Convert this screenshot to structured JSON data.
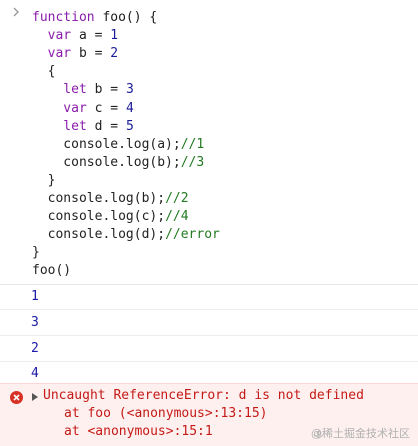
{
  "input": {
    "lines": [
      {
        "parts": [
          {
            "t": "function",
            "c": "kw"
          },
          {
            "t": " foo() {",
            "c": "fn"
          }
        ]
      },
      {
        "parts": [
          {
            "t": "  var",
            "c": "kw"
          },
          {
            "t": " a = ",
            "c": "plain"
          },
          {
            "t": "1",
            "c": "num"
          }
        ]
      },
      {
        "parts": [
          {
            "t": "  var",
            "c": "kw"
          },
          {
            "t": " b = ",
            "c": "plain"
          },
          {
            "t": "2",
            "c": "num"
          }
        ]
      },
      {
        "parts": [
          {
            "t": "  {",
            "c": "plain"
          }
        ]
      },
      {
        "parts": [
          {
            "t": "    let",
            "c": "kw"
          },
          {
            "t": " b = ",
            "c": "plain"
          },
          {
            "t": "3",
            "c": "num"
          }
        ]
      },
      {
        "parts": [
          {
            "t": "    var",
            "c": "kw"
          },
          {
            "t": " c = ",
            "c": "plain"
          },
          {
            "t": "4",
            "c": "num"
          }
        ]
      },
      {
        "parts": [
          {
            "t": "    let",
            "c": "kw"
          },
          {
            "t": " d = ",
            "c": "plain"
          },
          {
            "t": "5",
            "c": "num"
          }
        ]
      },
      {
        "parts": [
          {
            "t": "    console.log(a);",
            "c": "plain"
          },
          {
            "t": "//1",
            "c": "cm"
          }
        ]
      },
      {
        "parts": [
          {
            "t": "    console.log(b);",
            "c": "plain"
          },
          {
            "t": "//3",
            "c": "cm"
          }
        ]
      },
      {
        "parts": [
          {
            "t": "  }",
            "c": "plain"
          }
        ]
      },
      {
        "parts": [
          {
            "t": "  console.log(b);",
            "c": "plain"
          },
          {
            "t": "//2",
            "c": "cm"
          }
        ]
      },
      {
        "parts": [
          {
            "t": "  console.log(c);",
            "c": "plain"
          },
          {
            "t": "//4",
            "c": "cm"
          }
        ]
      },
      {
        "parts": [
          {
            "t": "  console.log(d);",
            "c": "plain"
          },
          {
            "t": "//error",
            "c": "cm"
          }
        ]
      },
      {
        "parts": [
          {
            "t": "}",
            "c": "plain"
          }
        ]
      },
      {
        "parts": [
          {
            "t": "foo()",
            "c": "plain"
          }
        ]
      }
    ]
  },
  "outputs": [
    "1",
    "3",
    "2",
    "4"
  ],
  "error": {
    "message": "Uncaught ReferenceError: d is not defined",
    "stack": [
      "at foo (<anonymous>:13:15)",
      "at <anonymous>:15:1"
    ]
  },
  "watermark": "@稀土掘金技术社区",
  "colors": {
    "keyword": "#8b1dac",
    "number": "#1c1c9a",
    "comment": "#237a23",
    "error": "#c41a16",
    "error_bg": "#fff0f0"
  },
  "icons": {
    "prompt": "chevron-right-icon",
    "error": "error-circle-icon",
    "expand": "expand-triangle-icon"
  }
}
